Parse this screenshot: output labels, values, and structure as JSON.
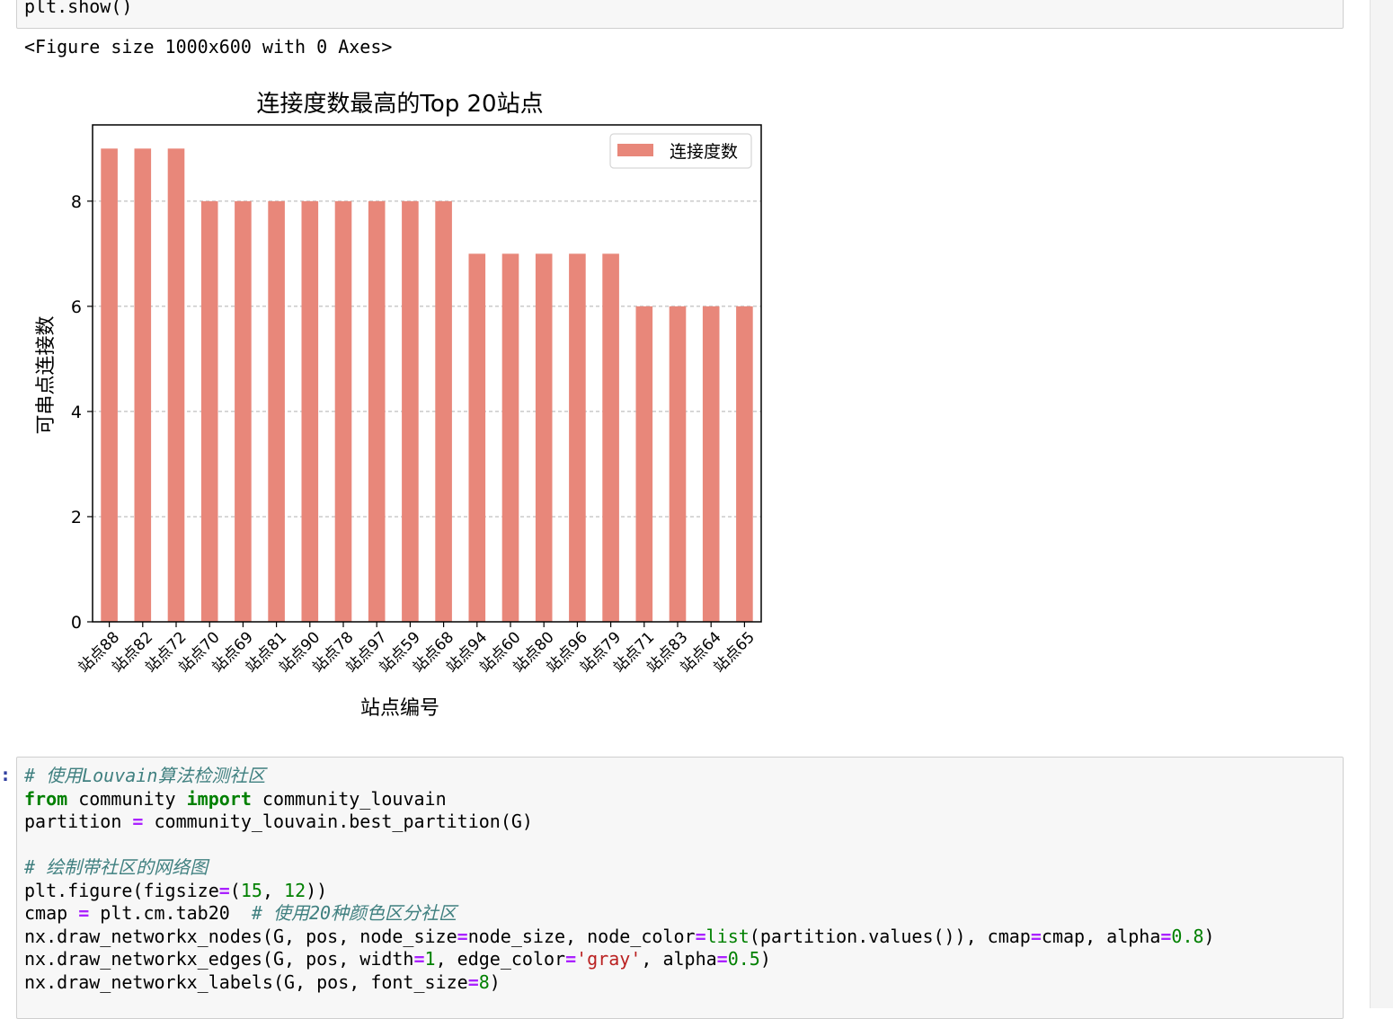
{
  "prev_cell": {
    "code": "plt.show()"
  },
  "stdout": "<Figure size 1000x600 with 0 Axes>",
  "chart_data": {
    "type": "bar",
    "title": "连接度数最高的Top 20站点",
    "xlabel": "站点编号",
    "ylabel": "可串点连接数",
    "categories": [
      "站点88",
      "站点82",
      "站点72",
      "站点70",
      "站点69",
      "站点81",
      "站点90",
      "站点78",
      "站点97",
      "站点59",
      "站点68",
      "站点94",
      "站点60",
      "站点80",
      "站点96",
      "站点79",
      "站点71",
      "站点83",
      "站点64",
      "站点65"
    ],
    "series": [
      {
        "name": "连接度数",
        "values": [
          9,
          9,
          9,
          8,
          8,
          8,
          8,
          8,
          8,
          8,
          8,
          7,
          7,
          7,
          7,
          7,
          6,
          6,
          6,
          6
        ]
      }
    ],
    "ylim": [
      0,
      9.45
    ],
    "yticks": [
      0,
      2,
      4,
      6,
      8
    ],
    "grid": "y-dashed",
    "legend": "top-right",
    "bar_color": "#e8877a"
  },
  "prompt": ":",
  "code_cell": {
    "lines": [
      [
        {
          "t": "# 使用Louvain算法检测社区",
          "c": "cm"
        }
      ],
      [
        {
          "t": "from",
          "c": "kw"
        },
        {
          "t": " community "
        },
        {
          "t": "import",
          "c": "kw"
        },
        {
          "t": " community_louvain"
        }
      ],
      [
        {
          "t": "partition "
        },
        {
          "t": "=",
          "c": "op"
        },
        {
          "t": " community_louvain.best_partition(G)"
        }
      ],
      [],
      [
        {
          "t": "# 绘制带社区的网络图",
          "c": "cm"
        }
      ],
      [
        {
          "t": "plt.figure(figsize"
        },
        {
          "t": "=",
          "c": "op"
        },
        {
          "t": "("
        },
        {
          "t": "15",
          "c": "num"
        },
        {
          "t": ", "
        },
        {
          "t": "12",
          "c": "num"
        },
        {
          "t": "))"
        }
      ],
      [
        {
          "t": "cmap "
        },
        {
          "t": "=",
          "c": "op"
        },
        {
          "t": " plt.cm.tab20  "
        },
        {
          "t": "# 使用20种颜色区分社区",
          "c": "cm"
        }
      ],
      [
        {
          "t": "nx.draw_networkx_nodes(G, pos, node_size"
        },
        {
          "t": "=",
          "c": "op"
        },
        {
          "t": "node_size, node_color"
        },
        {
          "t": "=",
          "c": "op"
        },
        {
          "t": "list",
          "c": "bi"
        },
        {
          "t": "(partition.values()), cmap"
        },
        {
          "t": "=",
          "c": "op"
        },
        {
          "t": "cmap, alpha"
        },
        {
          "t": "=",
          "c": "op"
        },
        {
          "t": "0.8",
          "c": "num"
        },
        {
          "t": ")"
        }
      ],
      [
        {
          "t": "nx.draw_networkx_edges(G, pos, width"
        },
        {
          "t": "=",
          "c": "op"
        },
        {
          "t": "1",
          "c": "num"
        },
        {
          "t": ", edge_color"
        },
        {
          "t": "=",
          "c": "op"
        },
        {
          "t": "'gray'",
          "c": "str"
        },
        {
          "t": ", alpha"
        },
        {
          "t": "=",
          "c": "op"
        },
        {
          "t": "0.5",
          "c": "num"
        },
        {
          "t": ")"
        }
      ],
      [
        {
          "t": "nx.draw_networkx_labels(G, pos, font_size"
        },
        {
          "t": "=",
          "c": "op"
        },
        {
          "t": "8",
          "c": "num"
        },
        {
          "t": ")"
        }
      ]
    ]
  }
}
